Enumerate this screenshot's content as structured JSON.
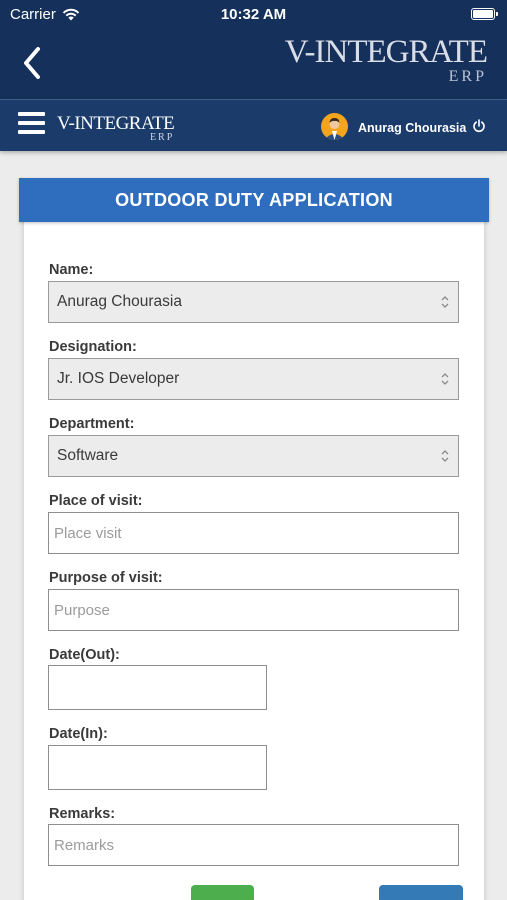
{
  "status_bar": {
    "carrier": "Carrier",
    "time": "10:32 AM"
  },
  "nav": {
    "logo_main": "V-INTEGRATE",
    "logo_sub": "ERP"
  },
  "app_bar": {
    "logo_main": "V-INTEGRATE",
    "logo_sub": "ERP",
    "user_name": "Anurag Chourasia"
  },
  "form": {
    "title": "OUTDOOR DUTY APPLICATION",
    "name": {
      "label": "Name:",
      "value": "Anurag Chourasia"
    },
    "designation": {
      "label": "Designation:",
      "value": "Jr. IOS Developer"
    },
    "department": {
      "label": "Department:",
      "value": "Software"
    },
    "place": {
      "label": "Place of visit:",
      "placeholder": "Place visit",
      "value": ""
    },
    "purpose": {
      "label": "Purpose of visit:",
      "placeholder": "Purpose",
      "value": ""
    },
    "date_out": {
      "label": "Date(Out):",
      "value": ""
    },
    "date_in": {
      "label": "Date(In):",
      "value": ""
    },
    "remarks": {
      "label": "Remarks:",
      "placeholder": "Remarks",
      "value": ""
    }
  },
  "icons": {
    "wifi": "wifi-icon",
    "battery": "battery-icon",
    "back": "chevron-left-icon",
    "menu": "hamburger-menu-icon",
    "avatar": "user-avatar",
    "power": "power-icon",
    "select_arrows": "up-down-chevron-icon"
  },
  "colors": {
    "nav_bg": "#15305a",
    "app_bar_bg": "#1b3b6b",
    "header_blue": "#2f6ebf",
    "submit_green": "#4cae4c",
    "action_blue": "#337ab7",
    "page_bg": "#ececec"
  }
}
